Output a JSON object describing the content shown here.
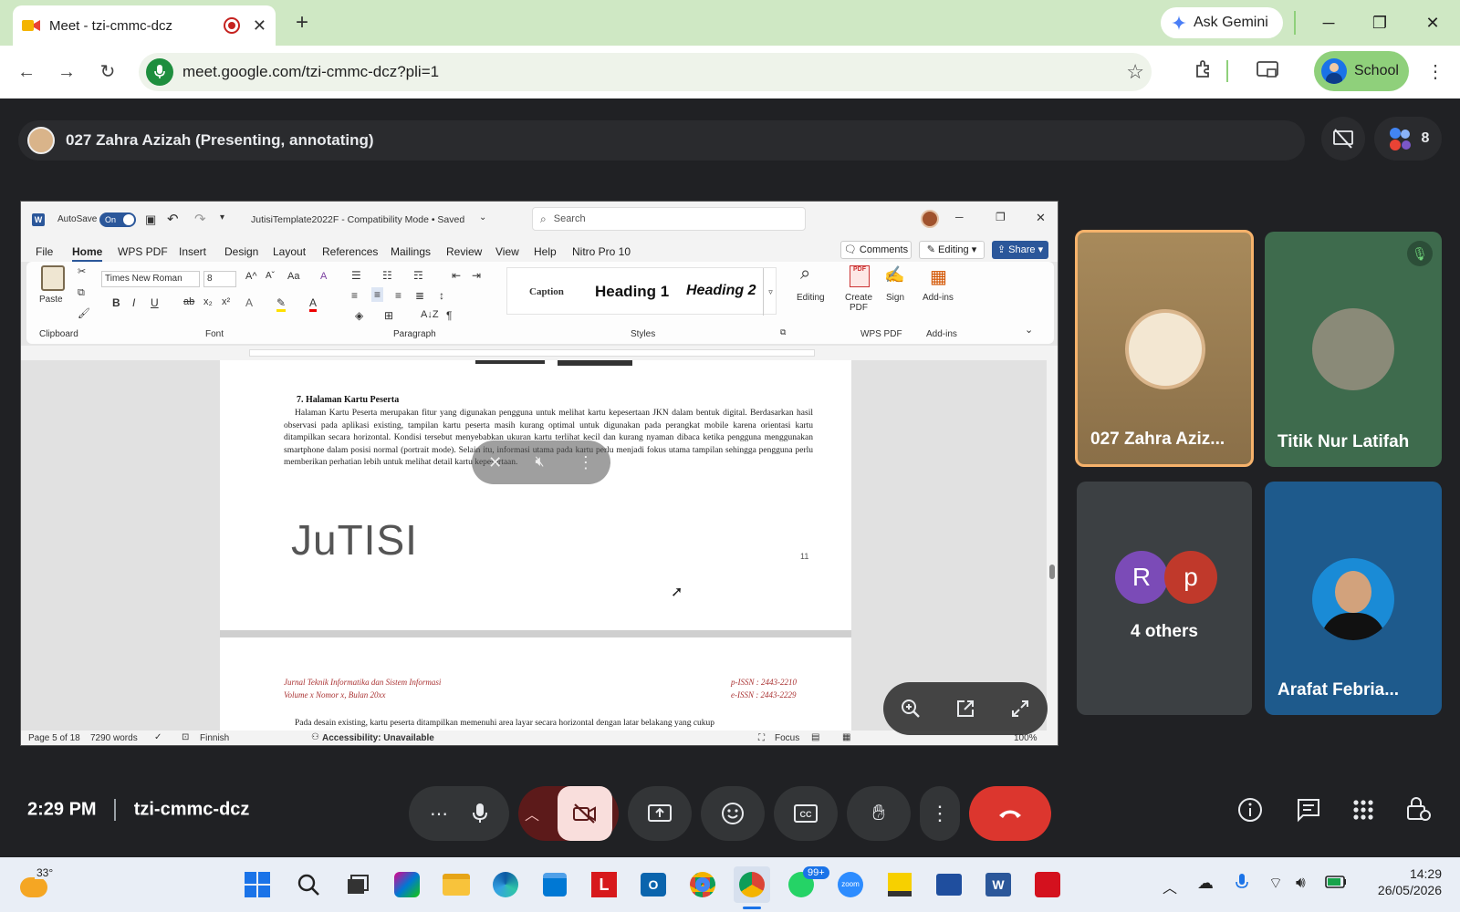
{
  "browser": {
    "tab_title": "Meet - tzi-cmmc-dcz",
    "new_tab": "+",
    "ask_gemini": "Ask Gemini",
    "url": "meet.google.com/tzi-cmmc-dcz?pli=1",
    "profile_label": "School"
  },
  "meet": {
    "presenter_label": "027 Zahra Azizah (Presenting, annotating)",
    "participant_count": "8",
    "time": "2:29 PM",
    "meeting_code": "tzi-cmmc-dcz",
    "tiles": [
      {
        "name": "027 Zahra Aziz..."
      },
      {
        "name": "Titik Nur Latifah"
      },
      {
        "name": "4 others",
        "initials": [
          "R",
          "p"
        ]
      },
      {
        "name": "Arafat Febria..."
      }
    ]
  },
  "word": {
    "autosave": "AutoSave",
    "toggle": "On",
    "filename": "JutisiTemplate2022F  -  Compatibility Mode • Saved",
    "search_placeholder": "Search",
    "menu": [
      "File",
      "Home",
      "WPS PDF",
      "Insert",
      "Design",
      "Layout",
      "References",
      "Mailings",
      "Review",
      "View",
      "Help",
      "Nitro Pro 10"
    ],
    "comments": "Comments",
    "editing": "Editing",
    "share": "Share",
    "font_name": "Times New Roman",
    "font_size": "8",
    "styles": [
      "Caption",
      "Heading 1",
      "Heading 2"
    ],
    "groups": [
      "Clipboard",
      "Font",
      "Paragraph",
      "Styles",
      "WPS PDF",
      "Add-ins"
    ],
    "paste": "Paste",
    "editing_btn": "Editing",
    "create_pdf": "Create PDF",
    "sign": "Sign",
    "addins": "Add-ins",
    "section_heading": "7. Halaman Kartu Peserta",
    "paragraph_1": "Halaman Kartu Peserta merupakan fitur yang digunakan pengguna untuk melihat kartu kepesertaan JKN dalam bentuk digital. Berdasarkan hasil observasi pada aplikasi existing, tampilan kartu peserta masih kurang optimal untuk digunakan pada perangkat mobile karena orientasi kartu ditampilkan secara horizontal. Kondisi tersebut menyebabkan ukuran kartu terlihat kecil dan kurang nyaman dibaca ketika pengguna menggunakan smartphone dalam posisi normal (portrait mode). Selain itu, informasi utama pada kartu perlu menjadi fokus utama tampilan sehingga pengguna perlu memberikan perhatian lebih untuk melihat detail kartu kepesertaan.",
    "logo_text": "JuTISI",
    "page_number": "11",
    "journal_line_1": "Jurnal Teknik Informatika dan Sistem Informasi",
    "journal_line_2": "Volume x Nomor x, Bulan 20xx",
    "issn_p": "p-ISSN : 2443-2210",
    "issn_e": "e-ISSN : 2443-2229",
    "paragraph_2": "Pada desain existing, kartu peserta ditampilkan memenuhi area layar secara horizontal dengan latar belakang yang cukup",
    "status_page": "Page 5 of 18",
    "status_words": "7290 words",
    "status_lang": "Finnish",
    "status_access": "Accessibility: Unavailable",
    "status_focus": "Focus",
    "zoom": "100%"
  },
  "taskbar": {
    "weather": "33°",
    "badge": "99+",
    "clock_time": "14:29",
    "clock_date": "26/05/2026"
  }
}
